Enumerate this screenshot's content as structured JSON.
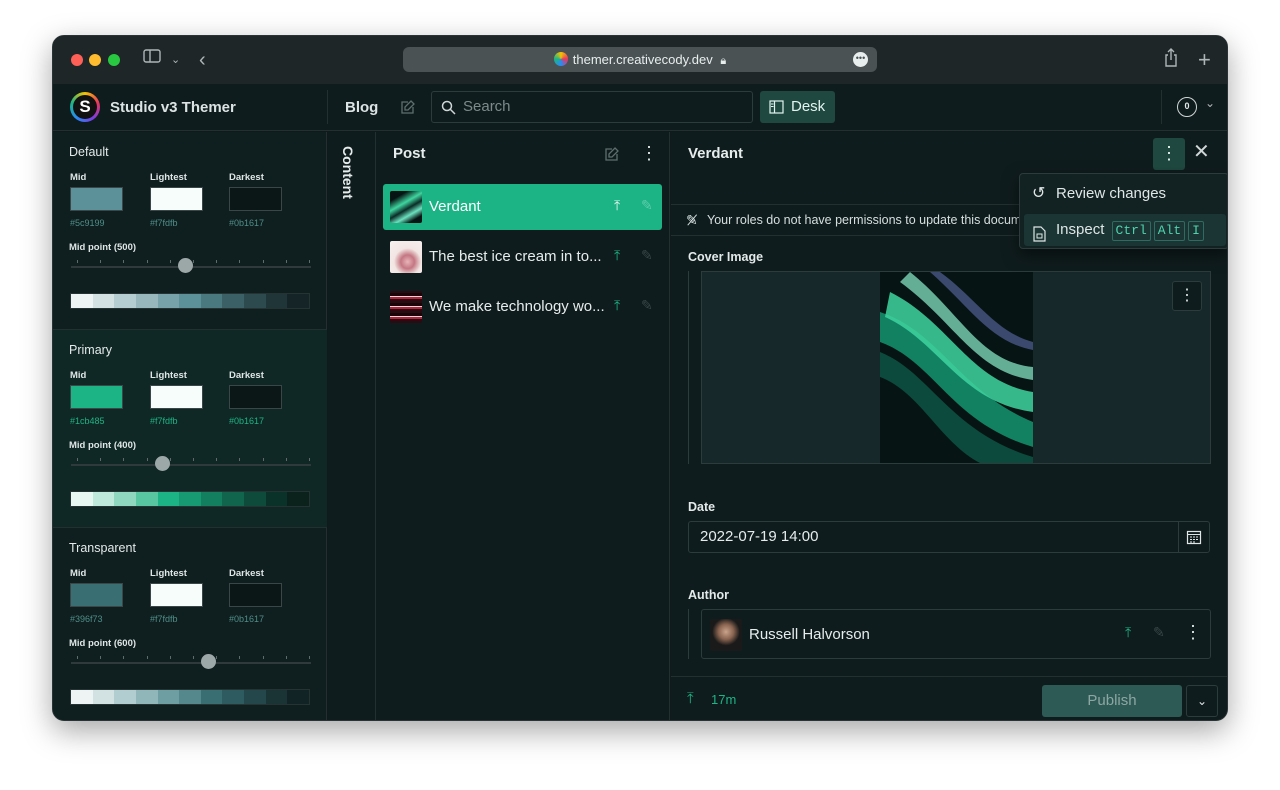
{
  "browser": {
    "url": "themer.creativecody.dev"
  },
  "app": {
    "title": "Studio v3 Themer",
    "blog": "Blog",
    "search_placeholder": "Search",
    "desk": "Desk",
    "badge": "0"
  },
  "sidebar": [
    {
      "title": "Default",
      "mid_label": "Mid",
      "lightest_label": "Lightest",
      "darkest_label": "Darkest",
      "mid": "#5c9199",
      "lightest": "#f7fdfb",
      "darkest": "#0b1617",
      "midpoint": "Mid point (500)",
      "level": 0.5,
      "ramp": [
        "#eef3f3",
        "#d4e1e2",
        "#b5cdd0",
        "#97b7bc",
        "#78a2a9",
        "#5c9199",
        "#4a7980",
        "#3b6166",
        "#2d4a4e",
        "#203538",
        "#152426"
      ]
    },
    {
      "title": "Primary",
      "mid_label": "Mid",
      "lightest_label": "Lightest",
      "darkest_label": "Darkest",
      "mid": "#1cb485",
      "lightest": "#f7fdfb",
      "darkest": "#0b1617",
      "midpoint": "Mid point (400)",
      "level": 0.4,
      "ramp": [
        "#e8f7f2",
        "#bfeadb",
        "#8fd8bf",
        "#58c6a0",
        "#1cb485",
        "#179a72",
        "#147f5f",
        "#11654c",
        "#0e4b3a",
        "#0b3229",
        "#0a211c"
      ]
    },
    {
      "title": "Transparent",
      "mid_label": "Mid",
      "lightest_label": "Lightest",
      "darkest_label": "Darkest",
      "mid": "#396f73",
      "lightest": "#f7fdfb",
      "darkest": "#0b1617",
      "midpoint": "Mid point (600)",
      "level": 0.6,
      "ramp": [
        "#eef4f4",
        "#d2e2e3",
        "#b2cdcf",
        "#91b6b9",
        "#6f9ea2",
        "#55888c",
        "#396f73",
        "#2e5b5f",
        "#23474a",
        "#1a3436",
        "#122325"
      ]
    }
  ],
  "content_tab": "Content",
  "posts": {
    "title": "Post",
    "items": [
      {
        "title": "Verdant",
        "selected": true
      },
      {
        "title": "The best ice cream in to...",
        "selected": false
      },
      {
        "title": "We make technology wo...",
        "selected": false
      }
    ]
  },
  "document": {
    "title": "Verdant",
    "permission": "Your roles do not have permissions to update this document",
    "cover_label": "Cover Image",
    "date_label": "Date",
    "date_value": "2022-07-19 14:00",
    "author_label": "Author",
    "author_name": "Russell Halvorson",
    "updated": "17m",
    "publish": "Publish"
  },
  "menu": {
    "review": "Review changes",
    "inspect": "Inspect",
    "keys": [
      "Ctrl",
      "Alt",
      "I"
    ]
  },
  "colors": {
    "accent": "#1cb485",
    "background": "#0e1a1b"
  }
}
